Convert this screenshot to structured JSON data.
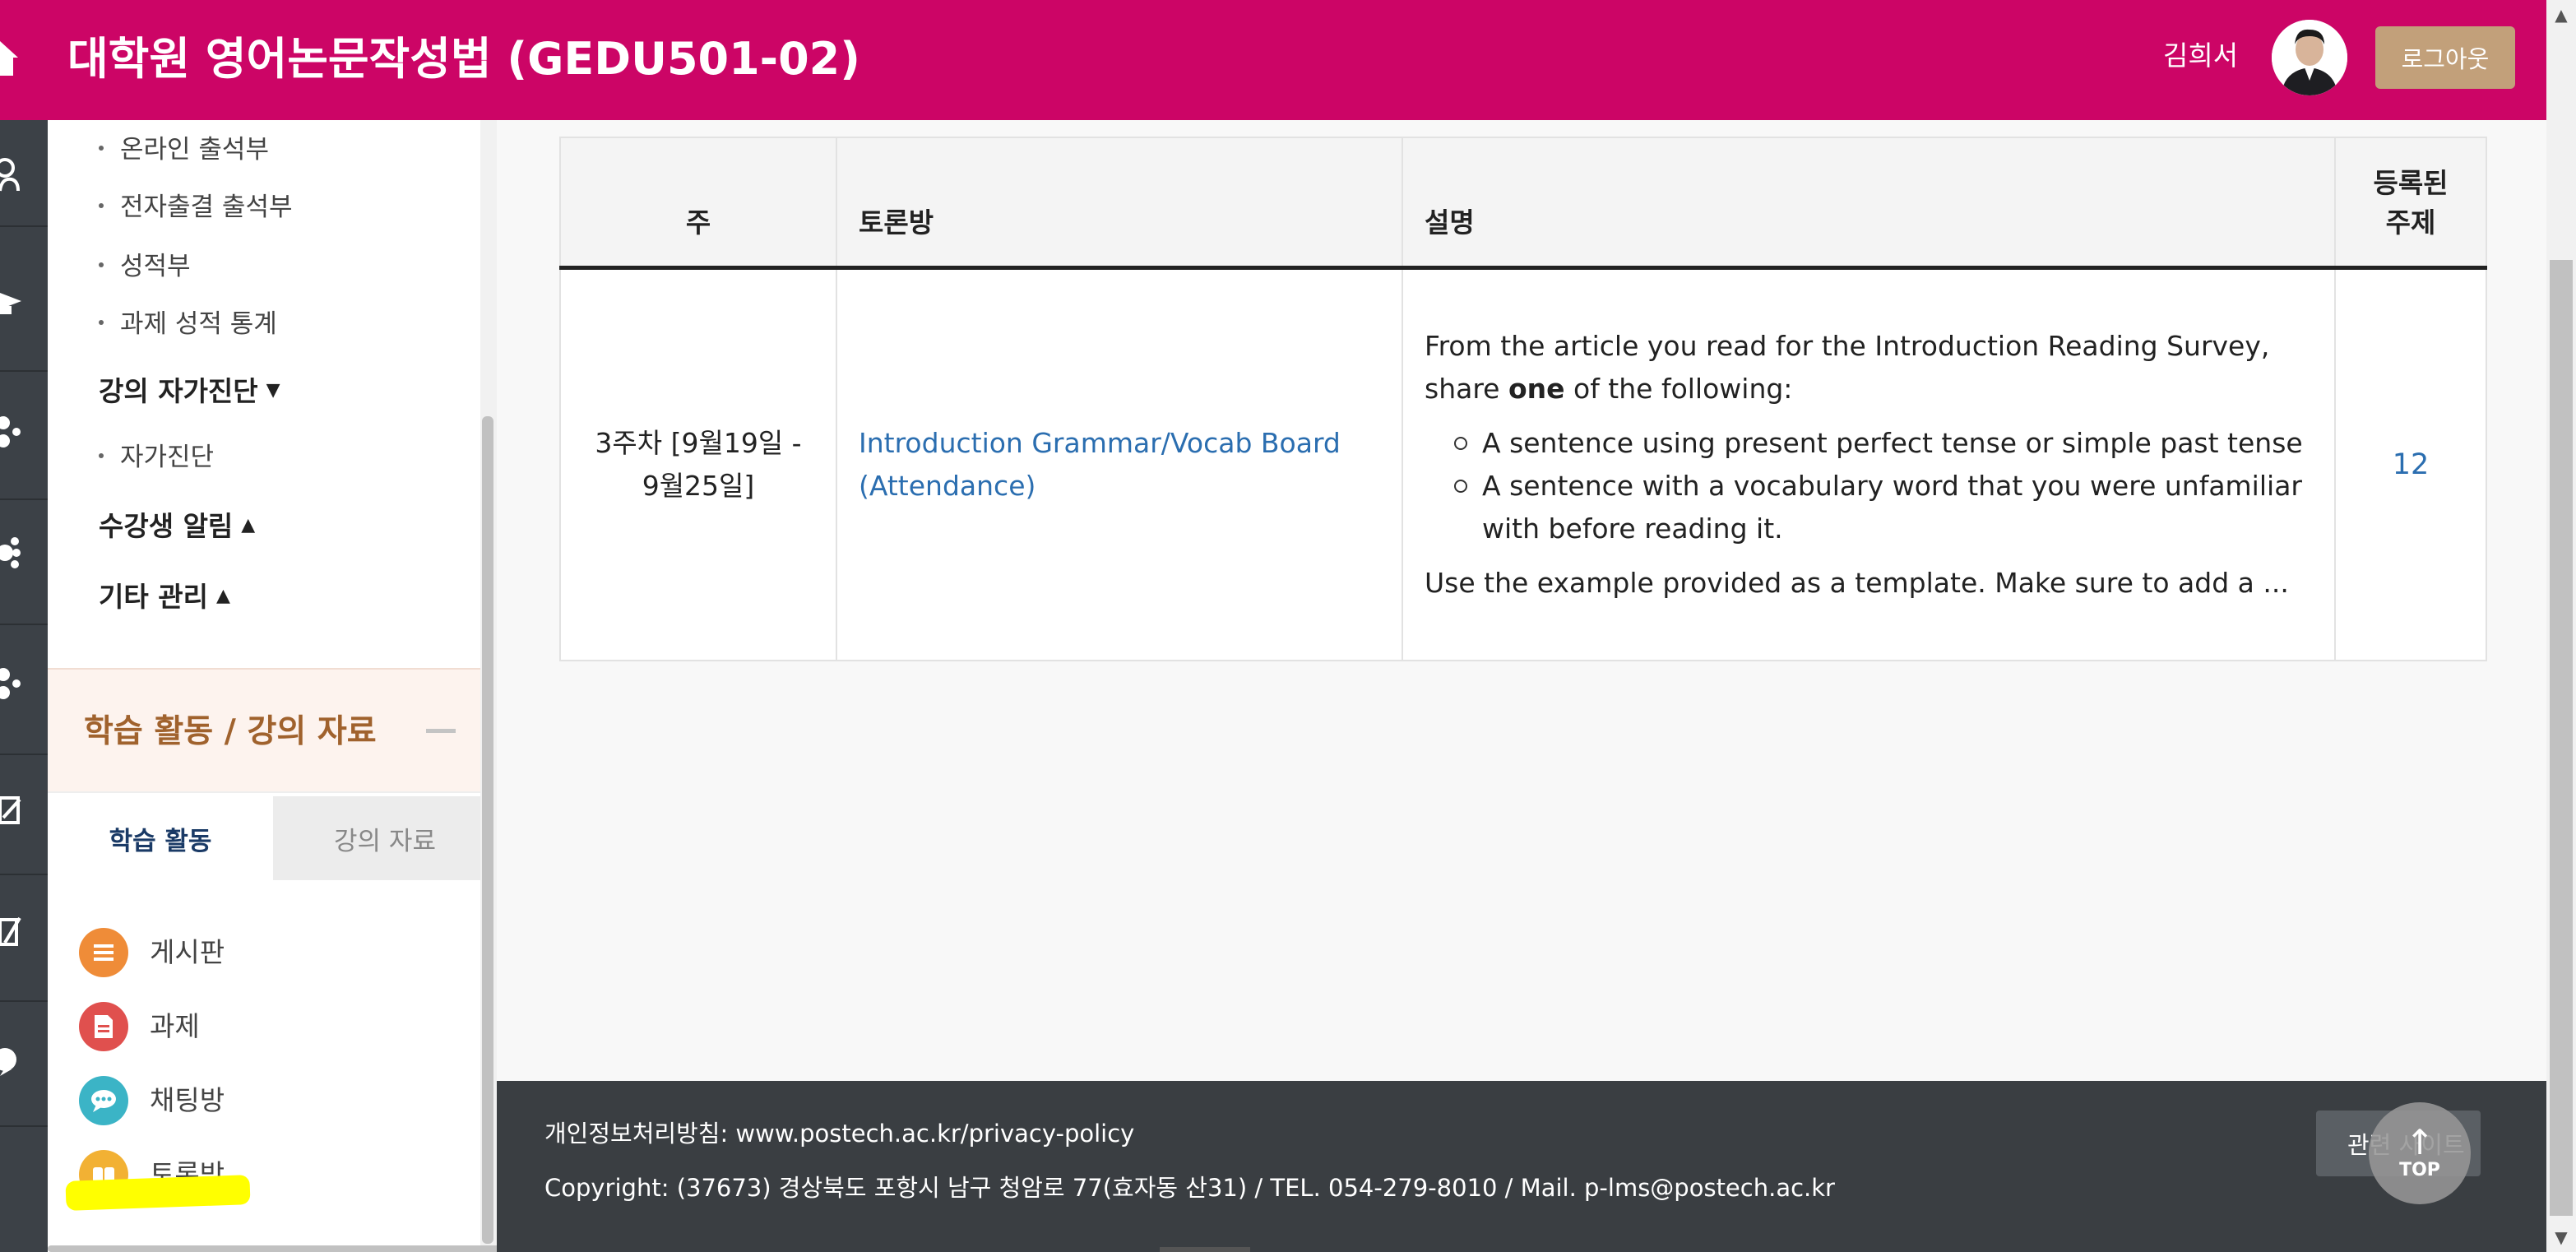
{
  "header": {
    "course_title": "대학원 영어논문작성법 (GEDU501-02)",
    "user_name": "김희서",
    "logout_label": "로그아웃",
    "brand_color": "#cc0566"
  },
  "rail": {
    "icons": [
      "person-icon",
      "graduation-cap-icon",
      "group-icon",
      "paw-icon",
      "group-icon",
      "edit-icon",
      "pencil-icon",
      "chat-icon"
    ]
  },
  "sidebar": {
    "attendance_items": [
      "온라인 출석부",
      "전자출결 출석부",
      "성적부",
      "과제 성적 통계"
    ],
    "self_diagnosis_heading": "강의 자가진단",
    "self_diagnosis_item": "자가진단",
    "notice_heading": "수강생 알림",
    "etc_heading": "기타 관리",
    "section_title": "학습 활동 / 강의 자료",
    "tabs": {
      "active": "학습 활동",
      "inactive": "강의 자료"
    },
    "activities": [
      {
        "label": "게시판",
        "icon": "board-icon",
        "color": "#ef8c38"
      },
      {
        "label": "과제",
        "icon": "assignment-icon",
        "color": "#e0504e"
      },
      {
        "label": "채팅방",
        "icon": "chat-icon",
        "color": "#3bb4c6"
      },
      {
        "label": "토론방",
        "icon": "discussion-icon",
        "color": "#f2b134"
      }
    ]
  },
  "table": {
    "headers": {
      "week": "주",
      "board": "토론방",
      "description": "설명",
      "topics_line1": "등록된",
      "topics_line2": "주제"
    },
    "row": {
      "week": "3주차 [9월19일 - 9월25일]",
      "board_title": "Introduction Grammar/Vocab Board (Attendance)",
      "desc_intro_pre": "From the article you read for the Introduction Reading Survey, share ",
      "desc_intro_bold": "one",
      "desc_intro_post": " of the following:",
      "desc_items": [
        "A sentence using present perfect tense or simple past tense",
        "A sentence with a vocabulary word that you were unfamiliar with before reading it."
      ],
      "desc_outro": "Use the example provided as a template.  Make sure to add a ...",
      "topic_count": "12"
    }
  },
  "footer": {
    "privacy": "개인정보처리방침: www.postech.ac.kr/privacy-policy",
    "copyright": "Copyright: (37673) 경상북도 포항시 남구 청암로 77(효자동 산31) / TEL. 054-279-8010 / Mail. p-lms@postech.ac.kr",
    "related_label": "관련 사이트"
  },
  "top_button": {
    "label": "TOP"
  }
}
